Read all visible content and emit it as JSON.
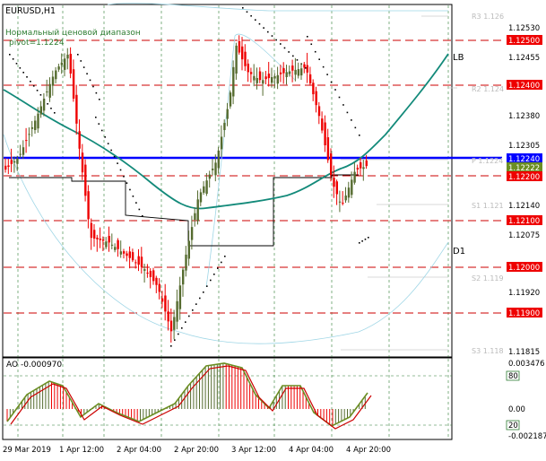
{
  "window": {
    "symbol_label": "EURUSD,H1",
    "indicator_name": "Нормальный ценовой диапазон",
    "pivot_label": "pivot=1.1224"
  },
  "colors": {
    "bull_body": "#556b2f",
    "bear_body": "#ee0000",
    "hline": "#cc0000",
    "pivot_line": "#0000ff",
    "ma": "#138a7a",
    "grid": "#2e7d32",
    "sar": "#000000",
    "channel": "#9fd6e6",
    "ao_line": "#6b8e23",
    "ao_signal": "#cc0000",
    "label_bg": "#ee0000",
    "current_bg": "#6b8e23",
    "level_bg": "#0000ff"
  },
  "main_axis": {
    "ticks": [
      "1.12530",
      "1.12455",
      "1.12380",
      "1.12305",
      "1.12230",
      "1.12140",
      "1.12075",
      "1.11995",
      "1.11920",
      "1.11815"
    ],
    "hlines": [
      {
        "label": "1.12500"
      },
      {
        "label": "1.12400"
      },
      {
        "label": "1.12200"
      },
      {
        "label": "1.12100"
      },
      {
        "label": "1.12000"
      },
      {
        "label": "1.11900"
      }
    ],
    "pivot_tag": "1.12240",
    "current_price": "1.12222"
  },
  "levels": {
    "r3": "R3 1.126",
    "r2": "R2 1.124",
    "p": "P 1.1224",
    "s1": "S1 1.121",
    "s2": "S2 1.119",
    "s3": "S3 1.118",
    "lb": "LB",
    "d1": "D1"
  },
  "ao_panel": {
    "title": "AO -0.000970",
    "ticks": [
      "0.003476",
      "0.00",
      "-0.002187"
    ],
    "level_80": "80",
    "level_20": "20"
  },
  "time_axis": [
    "29 Mar 2019",
    "1 Apr 12:00",
    "2 Apr 04:00",
    "2 Apr 20:00",
    "3 Apr 12:00",
    "4 Apr 04:00",
    "4 Apr 20:00"
  ]
}
